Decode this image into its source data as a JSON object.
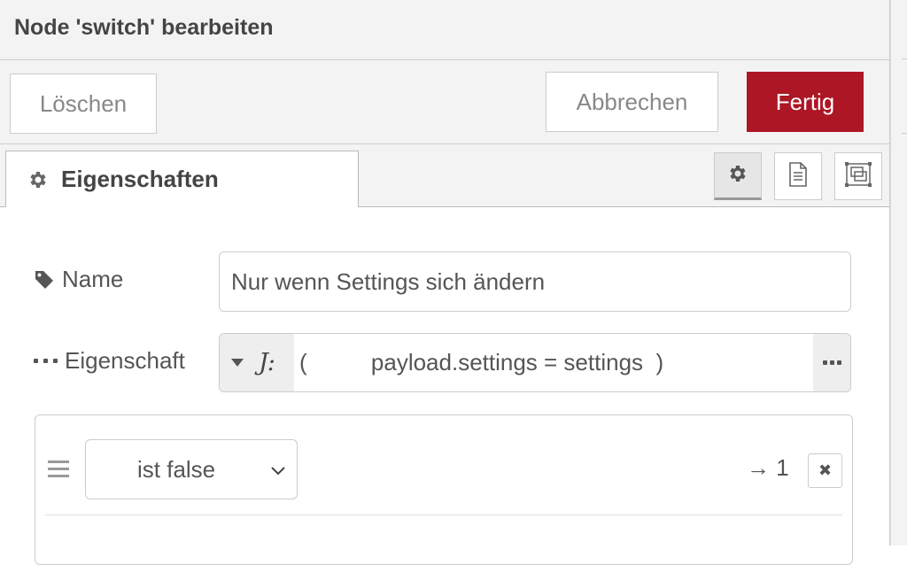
{
  "header": {
    "title": "Node 'switch' bearbeiten"
  },
  "toolbar": {
    "delete_label": "Löschen",
    "cancel_label": "Abbrechen",
    "done_label": "Fertig"
  },
  "tabs": {
    "active_label": "Eigenschaften",
    "active_icon": "gear-icon",
    "side_buttons": [
      "gear-icon",
      "document-icon",
      "frame-icon"
    ]
  },
  "form": {
    "name_label": "Name",
    "name_value": "Nur wenn Settings sich ändern",
    "property_label": "Eigenschaft",
    "property_type": "jsonata",
    "property_type_glyph": "J:",
    "property_expression": "(          payload.settings = settings  )"
  },
  "rules": [
    {
      "operator": "ist false",
      "output": "→ 1"
    }
  ],
  "colors": {
    "primary": "#ad1625",
    "header_bg": "#f3f3f3",
    "border": "#cccccc"
  }
}
